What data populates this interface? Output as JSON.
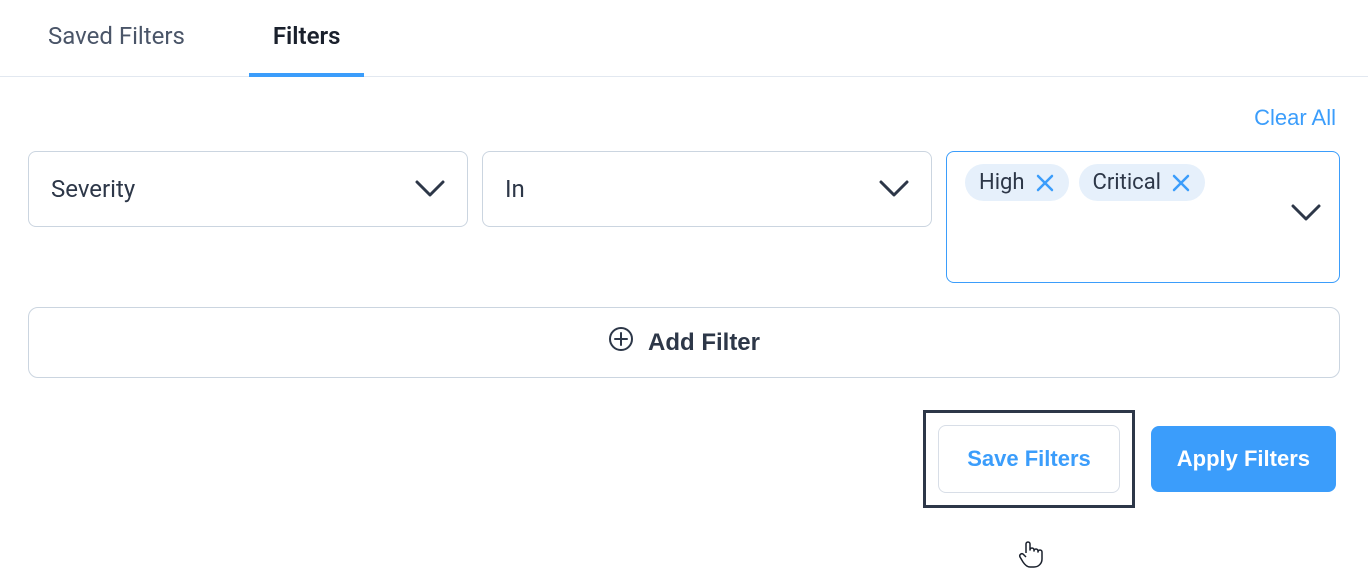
{
  "tabs": {
    "saved": "Saved Filters",
    "filters": "Filters"
  },
  "actions": {
    "clear_all": "Clear All",
    "add_filter": "Add Filter",
    "save_filters": "Save Filters",
    "apply_filters": "Apply Filters"
  },
  "filter": {
    "field": "Severity",
    "operator": "In",
    "values": {
      "0": "High",
      "1": "Critical"
    }
  }
}
